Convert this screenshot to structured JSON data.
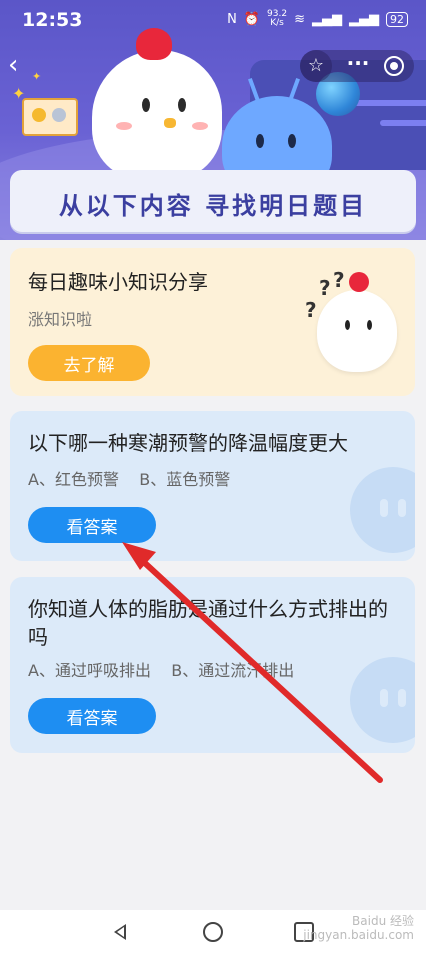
{
  "status_bar": {
    "time": "12:53",
    "net_speed": "93.2\nK/s",
    "battery": "92"
  },
  "banner": {
    "title": "从以下内容 寻找明日题目"
  },
  "tip_card": {
    "title": "每日趣味小知识分享",
    "subtitle": "涨知识啦",
    "button": "去了解"
  },
  "questions": [
    {
      "title": "以下哪一种寒潮预警的降温幅度更大",
      "options": "A、红色预警    B、蓝色预警",
      "button": "看答案"
    },
    {
      "title": "你知道人体的脂肪是通过什么方式排出的吗",
      "options": "A、通过呼吸排出    B、通过流汗排出",
      "button": "看答案"
    }
  ],
  "watermark": {
    "line1": "Baidu 经验",
    "line2": "jingyan.baidu.com"
  },
  "colors": {
    "accent_blue": "#1e8ef2",
    "accent_orange": "#fbb330",
    "annotation_red": "#e02a2a"
  }
}
